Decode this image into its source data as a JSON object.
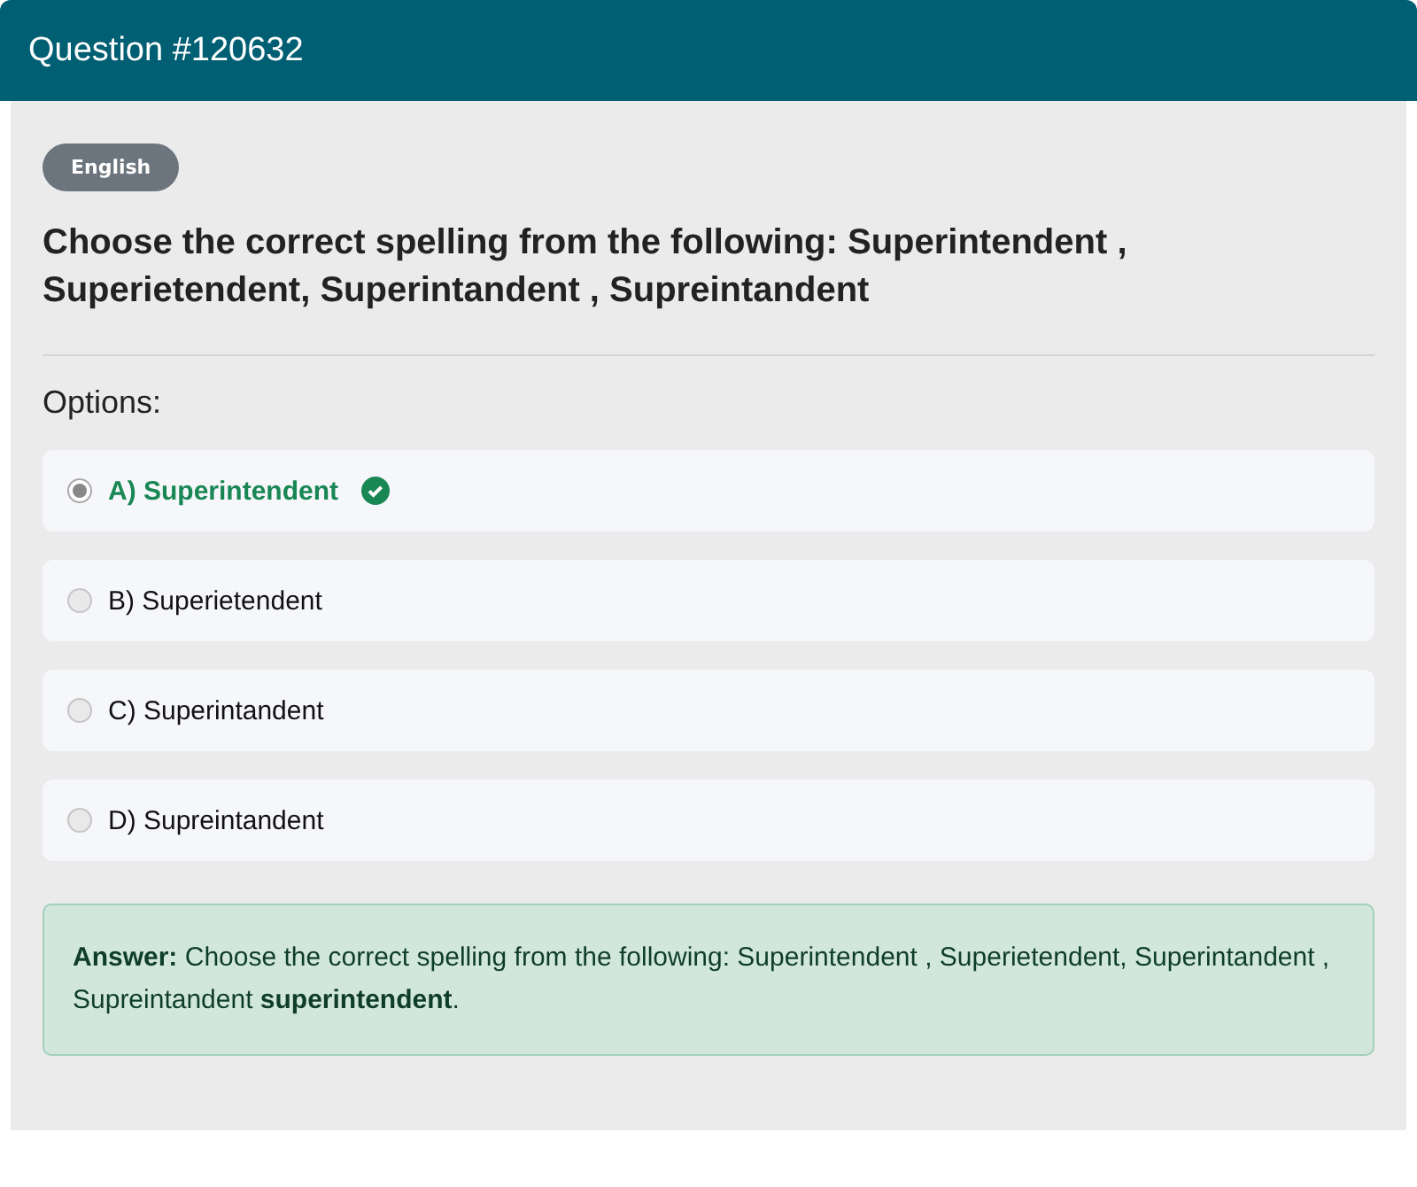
{
  "header": {
    "title": "Question #120632"
  },
  "language_badge": "English",
  "question": "Choose the correct spelling from the following: Superintendent , Superietendent, Superintandent , Supreintandent",
  "options_label": "Options:",
  "options": [
    {
      "label": "A) Superintendent",
      "selected": true,
      "correct": true
    },
    {
      "label": "B) Superietendent",
      "selected": false,
      "correct": false
    },
    {
      "label": "C) Superintandent",
      "selected": false,
      "correct": false
    },
    {
      "label": "D) Supreintandent",
      "selected": false,
      "correct": false
    }
  ],
  "answer": "**Answer:** Choose the correct spelling from the following: Superintendent , Superietendent, Superintandent , Supreintandent **superintendent**."
}
